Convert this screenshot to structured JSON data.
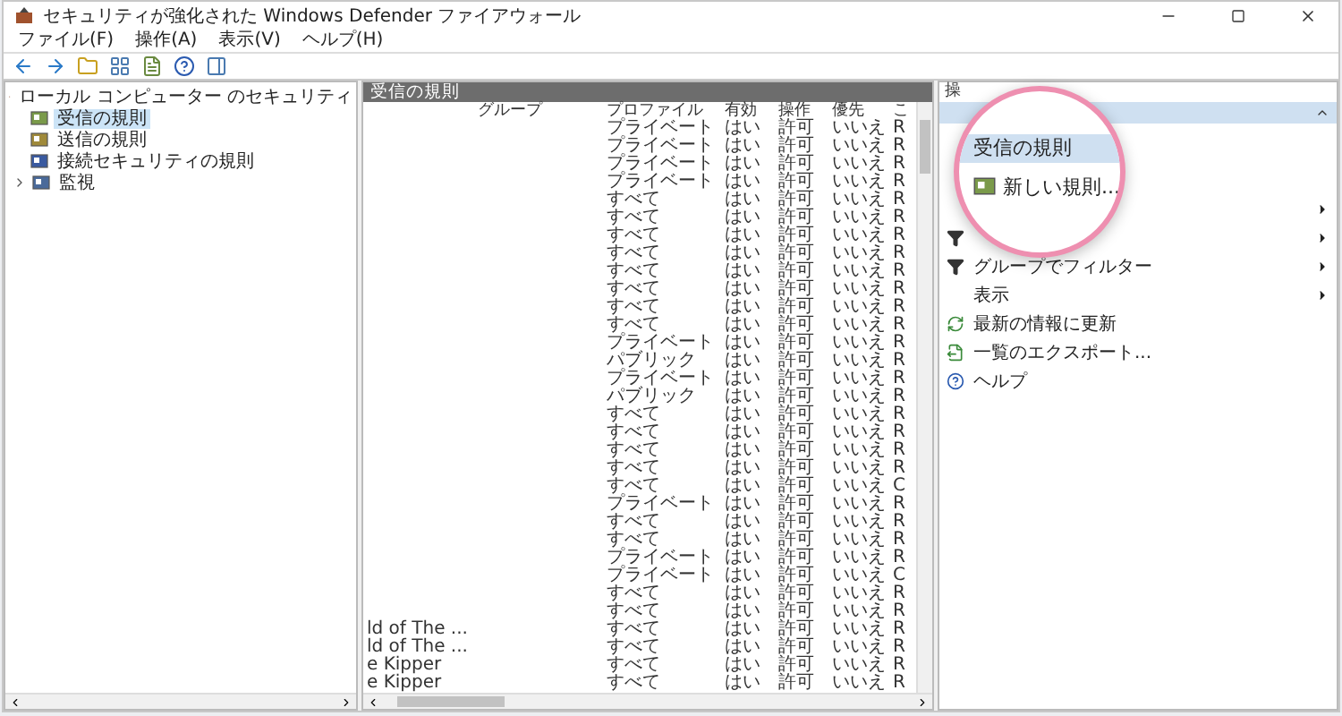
{
  "window": {
    "title": "セキュリティが強化された Windows Defender ファイアウォール"
  },
  "menu": [
    "ファイル(F)",
    "操作(A)",
    "表示(V)",
    "ヘルプ(H)"
  ],
  "tree": {
    "label": "ローカル コンピューター のセキュリティ",
    "children": [
      {
        "label": "受信の規則",
        "selected": true,
        "kind": "inbound"
      },
      {
        "label": "送信の規則",
        "selected": false,
        "kind": "outbound"
      },
      {
        "label": "接続セキュリティの規則",
        "selected": false,
        "kind": "connection"
      },
      {
        "label": "監視",
        "selected": false,
        "kind": "monitor",
        "expanded": false
      }
    ]
  },
  "rules_pane": {
    "title": "受信の規則",
    "columns": [
      "グループ",
      "プロファイル",
      "有効",
      "操作",
      "優先",
      "こ"
    ],
    "rows": [
      {
        "profile": "プライベート",
        "enabled": "はい",
        "action": "許可",
        "override": "いいえ",
        "column_7": "R"
      },
      {
        "profile": "プライベート",
        "enabled": "はい",
        "action": "許可",
        "override": "いいえ",
        "column_7": "R"
      },
      {
        "profile": "プライベート",
        "enabled": "はい",
        "action": "許可",
        "override": "いいえ",
        "column_7": "R"
      },
      {
        "profile": "プライベート",
        "enabled": "はい",
        "action": "許可",
        "override": "いいえ",
        "column_7": "R"
      },
      {
        "profile": "すべて",
        "enabled": "はい",
        "action": "許可",
        "override": "いいえ",
        "column_7": "R"
      },
      {
        "profile": "すべて",
        "enabled": "はい",
        "action": "許可",
        "override": "いいえ",
        "column_7": "R"
      },
      {
        "profile": "すべて",
        "enabled": "はい",
        "action": "許可",
        "override": "いいえ",
        "column_7": "R"
      },
      {
        "profile": "すべて",
        "enabled": "はい",
        "action": "許可",
        "override": "いいえ",
        "column_7": "R"
      },
      {
        "profile": "すべて",
        "enabled": "はい",
        "action": "許可",
        "override": "いいえ",
        "column_7": "R"
      },
      {
        "profile": "すべて",
        "enabled": "はい",
        "action": "許可",
        "override": "いいえ",
        "column_7": "R"
      },
      {
        "profile": "すべて",
        "enabled": "はい",
        "action": "許可",
        "override": "いいえ",
        "column_7": "R"
      },
      {
        "profile": "すべて",
        "enabled": "はい",
        "action": "許可",
        "override": "いいえ",
        "column_7": "R"
      },
      {
        "profile": "プライベート",
        "enabled": "はい",
        "action": "許可",
        "override": "いいえ",
        "column_7": "R"
      },
      {
        "profile": "パブリック",
        "enabled": "はい",
        "action": "許可",
        "override": "いいえ",
        "column_7": "R"
      },
      {
        "profile": "プライベート",
        "enabled": "はい",
        "action": "許可",
        "override": "いいえ",
        "column_7": "R"
      },
      {
        "profile": "パブリック",
        "enabled": "はい",
        "action": "許可",
        "override": "いいえ",
        "column_7": "R"
      },
      {
        "profile": "すべて",
        "enabled": "はい",
        "action": "許可",
        "override": "いいえ",
        "column_7": "R"
      },
      {
        "profile": "すべて",
        "enabled": "はい",
        "action": "許可",
        "override": "いいえ",
        "column_7": "R"
      },
      {
        "profile": "すべて",
        "enabled": "はい",
        "action": "許可",
        "override": "いいえ",
        "column_7": "R"
      },
      {
        "profile": "すべて",
        "enabled": "はい",
        "action": "許可",
        "override": "いいえ",
        "column_7": "R"
      },
      {
        "profile": "すべて",
        "enabled": "はい",
        "action": "許可",
        "override": "いいえ",
        "column_7": "C"
      },
      {
        "profile": "プライベート",
        "enabled": "はい",
        "action": "許可",
        "override": "いいえ",
        "column_7": "R"
      },
      {
        "profile": "すべて",
        "enabled": "はい",
        "action": "許可",
        "override": "いいえ",
        "column_7": "R"
      },
      {
        "profile": "すべて",
        "enabled": "はい",
        "action": "許可",
        "override": "いいえ",
        "column_7": "R"
      },
      {
        "profile": "プライベート",
        "enabled": "はい",
        "action": "許可",
        "override": "いいえ",
        "column_7": "R"
      },
      {
        "profile": "プライベート",
        "enabled": "はい",
        "action": "許可",
        "override": "いいえ",
        "column_7": "C"
      },
      {
        "profile": "すべて",
        "enabled": "はい",
        "action": "許可",
        "override": "いいえ",
        "column_7": "R"
      },
      {
        "profile": "すべて",
        "enabled": "はい",
        "action": "許可",
        "override": "いいえ",
        "column_7": "R"
      },
      {
        "name": "ld of The ...",
        "profile": "すべて",
        "enabled": "はい",
        "action": "許可",
        "override": "いいえ",
        "column_7": "R"
      },
      {
        "name": "ld of The ...",
        "profile": "すべて",
        "enabled": "はい",
        "action": "許可",
        "override": "いいえ",
        "column_7": "R"
      },
      {
        "name": "e Kipper",
        "profile": "すべて",
        "enabled": "はい",
        "action": "許可",
        "override": "いいえ",
        "column_7": "R"
      },
      {
        "name": "e Kipper",
        "profile": "すべて",
        "enabled": "はい",
        "action": "許可",
        "override": "いいえ",
        "column_7": "R"
      }
    ]
  },
  "actions_pane": {
    "title": "操",
    "items": [
      {
        "kind": "blank",
        "submenu": true
      },
      {
        "kind": "filter",
        "submenu": true
      },
      {
        "kind": "filter",
        "label": "グループでフィルター",
        "submenu": true
      },
      {
        "kind": "blank",
        "label": "表示",
        "submenu": true
      },
      {
        "kind": "refresh",
        "label": "最新の情報に更新",
        "submenu": false
      },
      {
        "kind": "export",
        "label": "一覧のエクスポート...",
        "submenu": false
      },
      {
        "kind": "help",
        "label": "ヘルプ",
        "submenu": false
      }
    ]
  },
  "magnifier": {
    "section_title": "受信の規則",
    "item": "新しい規則..."
  }
}
